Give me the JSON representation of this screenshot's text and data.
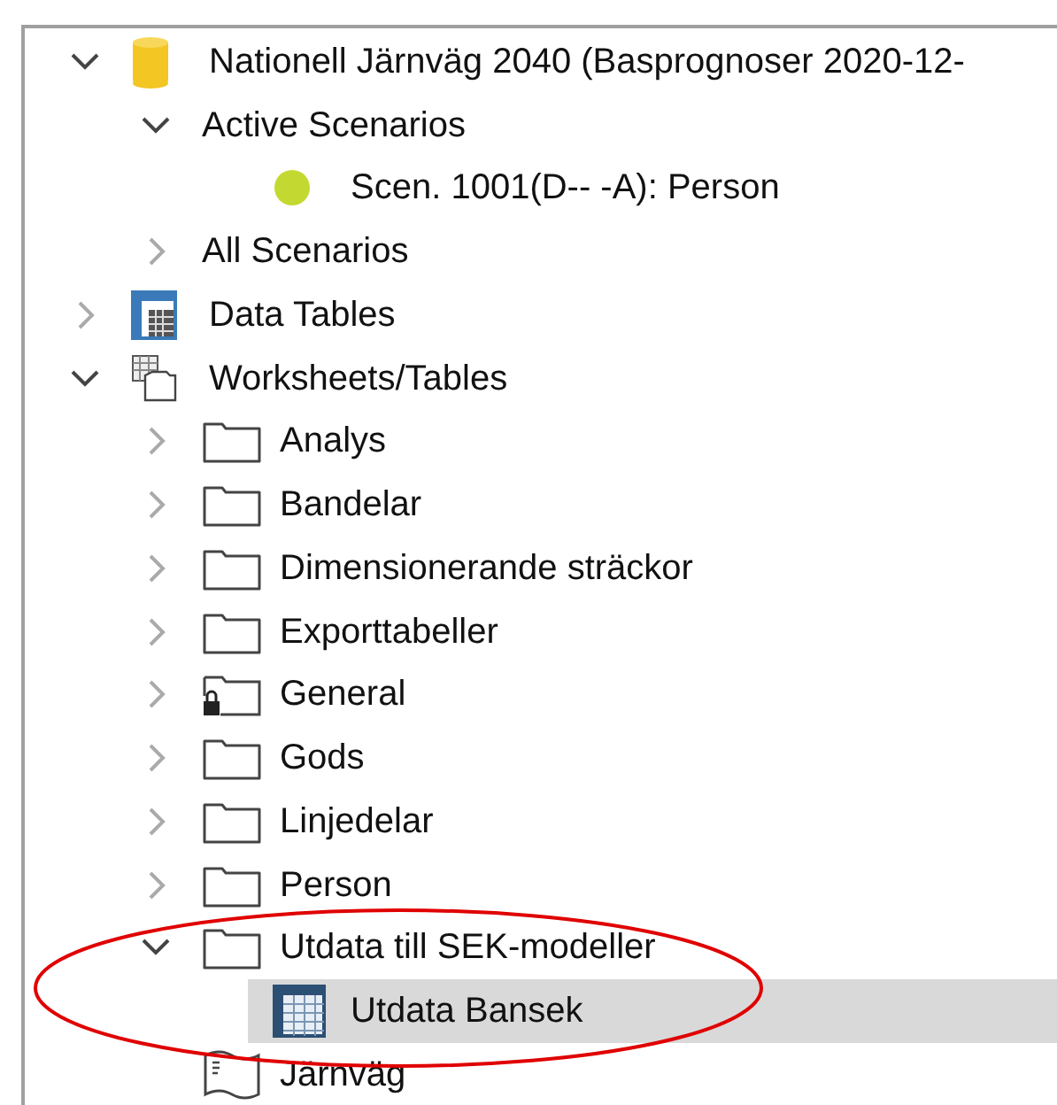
{
  "tree": [
    {
      "label": "Nationell Järnväg 2040 (Basprognoser 2020-12-",
      "kind": "database",
      "expanded": true,
      "selected": false,
      "children": [
        {
          "label": "Active Scenarios",
          "kind": "plain",
          "expanded": true,
          "selected": false,
          "children": [
            {
              "label": "Scen. 1001(D-- -A): Person",
              "kind": "dot",
              "color": "#c3d932",
              "selected": false
            }
          ]
        },
        {
          "label": "All Scenarios",
          "kind": "plain",
          "expanded": false,
          "selected": false
        }
      ]
    },
    {
      "label": "Data Tables",
      "kind": "datatables",
      "expanded": false,
      "selected": false
    },
    {
      "label": "Worksheets/Tables",
      "kind": "worksheets",
      "expanded": true,
      "selected": false,
      "children": [
        {
          "label": "Analys",
          "kind": "folder",
          "expanded": false,
          "selected": false
        },
        {
          "label": "Bandelar",
          "kind": "folder",
          "expanded": false,
          "selected": false
        },
        {
          "label": "Dimensionerande sträckor",
          "kind": "folder",
          "expanded": false,
          "selected": false
        },
        {
          "label": "Exporttabeller",
          "kind": "folder",
          "expanded": false,
          "selected": false
        },
        {
          "label": "General",
          "kind": "locked",
          "expanded": false,
          "selected": false
        },
        {
          "label": "Gods",
          "kind": "folder",
          "expanded": false,
          "selected": false
        },
        {
          "label": "Linjedelar",
          "kind": "folder",
          "expanded": false,
          "selected": false
        },
        {
          "label": "Person",
          "kind": "folder",
          "expanded": false,
          "selected": false
        },
        {
          "label": "Utdata till SEK-modeller",
          "kind": "folder",
          "expanded": true,
          "selected": false,
          "children": [
            {
              "label": "Utdata Bansek",
              "kind": "table",
              "selected": true
            }
          ]
        },
        {
          "label": "Järnväg",
          "kind": "sheet",
          "selected": false
        }
      ]
    }
  ]
}
